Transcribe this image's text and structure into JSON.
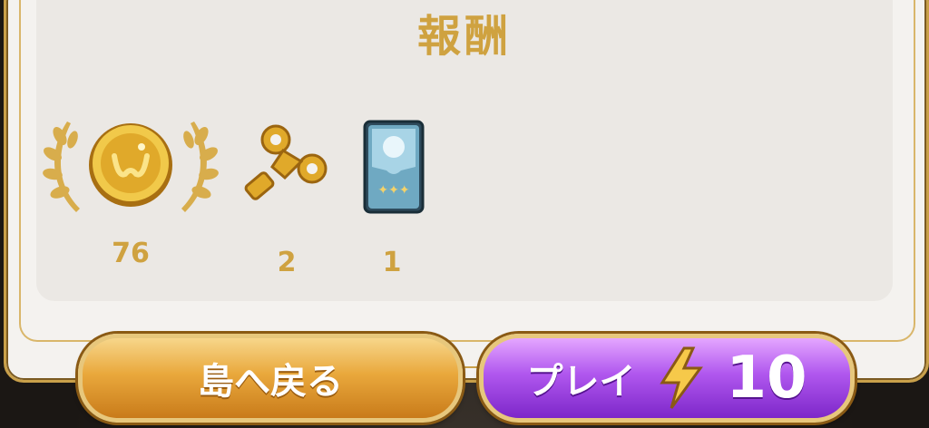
{
  "title": "報酬",
  "rewards": [
    {
      "icon": "gold-coin-icon",
      "count": "76"
    },
    {
      "icon": "wind-up-key-icon",
      "count": "2"
    },
    {
      "icon": "card-pack-icon",
      "count": "1"
    }
  ],
  "buttons": {
    "back_label": "島へ戻る",
    "play_label": "プレイ",
    "play_cost": "10"
  },
  "colors": {
    "gold": "#cfa240",
    "back_button": "#e9a83c",
    "play_button": "#b057ee"
  }
}
